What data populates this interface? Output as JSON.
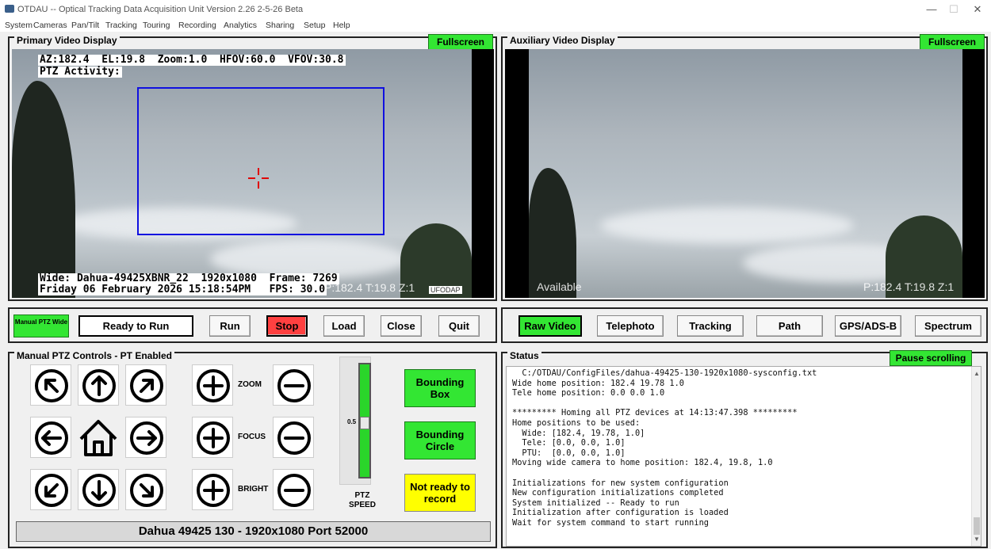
{
  "window": {
    "title": "OTDAU -- Optical Tracking Data Acquisition Unit  Version 2.26 2-5-26 Beta"
  },
  "menu": [
    "System",
    "Cameras",
    "Pan/Tilt",
    "Tracking",
    "Touring",
    "Recording",
    "Analytics",
    "Sharing",
    "Setup",
    "Help"
  ],
  "primary": {
    "title": "Primary Video Display",
    "fullscreen": "Fullscreen",
    "overlay_line1": "AZ:182.4  EL:19.8  Zoom:1.0  HFOV:60.0  VFOV:30.8",
    "overlay_line2": "PTZ Activity:",
    "overlay_line3": "Wide: Dahua-49425XBNR_22  1920x1080  Frame: 7269",
    "overlay_line4": "Friday 06 February 2026 15:18:54PM   FPS: 30.0",
    "ghost_pos": "P:182.4 T:19.8 Z:1",
    "logo": "UFODAP"
  },
  "auxiliary": {
    "title": "Auxiliary Video Display",
    "fullscreen": "Fullscreen",
    "available": "Available",
    "ghost_pos": "P:182.4 T:19.8 Z:1"
  },
  "controlbar": {
    "manual_ptz": "Manual PTZ Wide",
    "ready": "Ready to Run",
    "run": "Run",
    "stop": "Stop",
    "load": "Load",
    "close": "Close",
    "quit": "Quit"
  },
  "auxbar": {
    "raw_video": "Raw Video",
    "telephoto": "Telephoto",
    "tracking": "Tracking",
    "path": "Path",
    "gps": "GPS/ADS-B",
    "spectrum": "Spectrum"
  },
  "ptz": {
    "title": "Manual PTZ Controls - PT Enabled",
    "zoom": "ZOOM",
    "focus": "FOCUS",
    "bright": "BRIGHT",
    "slider_value": "0.5",
    "speed_label": "PTZ SPEED",
    "bounding_box": "Bounding Box",
    "bounding_circle": "Bounding Circle",
    "not_ready": "Not ready to record",
    "camera_info": "Dahua 49425 130 - 1920x1080  Port 52000",
    "speed_level": 0.5
  },
  "status": {
    "title": "Status",
    "pause": "Pause scrolling",
    "lines": [
      "  C:/OTDAU/ConfigFiles/dahua-49425-130-1920x1080-sysconfig.txt",
      "Wide home position: 182.4 19.78 1.0",
      "Tele home position: 0.0 0.0 1.0",
      "",
      "********* Homing all PTZ devices at 14:13:47.398 *********",
      "Home positions to be used:",
      "  Wide: [182.4, 19.78, 1.0]",
      "  Tele: [0.0, 0.0, 1.0]",
      "  PTU:  [0.0, 0.0, 1.0]",
      "Moving wide camera to home position: 182.4, 19.8, 1.0",
      "",
      "Initializations for new system configuration",
      "New configuration initializations completed",
      "System initialized -- Ready to run",
      "Initialization after configuration is loaded",
      "Wait for system command to start running"
    ]
  },
  "colors": {
    "green": "#33e633",
    "red": "#ff4040",
    "yellow": "#ffff00",
    "track_box": "#1010e0",
    "crosshair": "#e00000"
  }
}
